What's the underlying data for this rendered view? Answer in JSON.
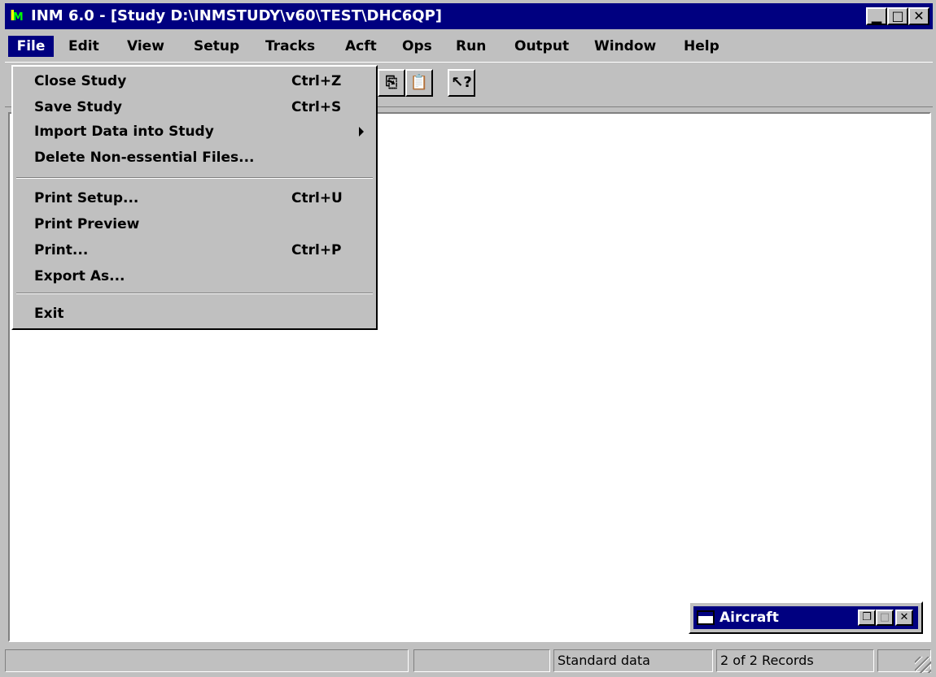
{
  "window": {
    "title": "INM 6.0 - [Study D:\\INMSTUDY\\v60\\TEST\\DHC6QP]",
    "icon_text_1": "I",
    "icon_text_2": "M",
    "minimize_icon": "minimize-icon",
    "restore_icon": "restore-icon",
    "close_icon": "close-icon"
  },
  "menubar": {
    "file": "File",
    "edit": "Edit",
    "view": "View",
    "setup": "Setup",
    "tracks": "Tracks",
    "acft": "Acft",
    "ops": "Ops",
    "run": "Run",
    "output": "Output",
    "window": "Window",
    "help": "Help"
  },
  "toolbar": {
    "visible_buttons": [
      "copy-icon",
      "paste-icon",
      "context-help-icon"
    ],
    "help_glyph": "?"
  },
  "file_menu": {
    "items": [
      {
        "label": "Close Study",
        "shortcut": "Ctrl+Z"
      },
      {
        "label": "Save Study",
        "shortcut": "Ctrl+S"
      },
      {
        "label": "Import Data into Study",
        "shortcut": ""
      },
      {
        "label": "Delete Non-essential Files...",
        "shortcut": ""
      },
      {
        "label": "Print Setup...",
        "shortcut": "Ctrl+U"
      },
      {
        "label": "Print Preview",
        "shortcut": ""
      },
      {
        "label": "Print...",
        "shortcut": "Ctrl+P"
      },
      {
        "label": "Export As...",
        "shortcut": ""
      },
      {
        "label": "Exit",
        "shortcut": ""
      }
    ]
  },
  "child_window": {
    "title": "Aircraft"
  },
  "statusbar": {
    "data_source": "Standard data",
    "records": "2 of 2  Records"
  },
  "colors": {
    "titlebar": "#000080",
    "face": "#c0c0c0",
    "client": "#ffffff"
  }
}
